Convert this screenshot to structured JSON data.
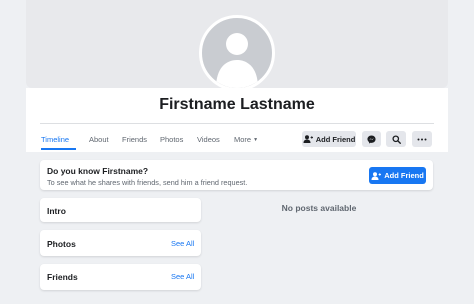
{
  "profile": {
    "name": "Firstname Lastname"
  },
  "tabs": [
    {
      "label": "Timeline"
    },
    {
      "label": "About"
    },
    {
      "label": "Friends"
    },
    {
      "label": "Photos"
    },
    {
      "label": "Videos"
    },
    {
      "label": "More"
    }
  ],
  "actions": {
    "add_friend_label": "Add Friend",
    "messenger_icon": "messenger-icon",
    "search_icon": "search-icon",
    "more_icon": "ellipsis-icon"
  },
  "know_card": {
    "title": "Do you know Firstname?",
    "subtitle": "To see what he shares with friends, send him a friend request.",
    "button_label": "Add Friend"
  },
  "sidebar": {
    "intro": {
      "title": "Intro"
    },
    "photos": {
      "title": "Photos",
      "link": "See All"
    },
    "friends": {
      "title": "Friends",
      "link": "See All"
    }
  },
  "feed": {
    "empty_text": "No posts available"
  },
  "colors": {
    "accent": "#1877f2",
    "background": "#eef0f3",
    "button_gray": "#e4e6eb"
  }
}
